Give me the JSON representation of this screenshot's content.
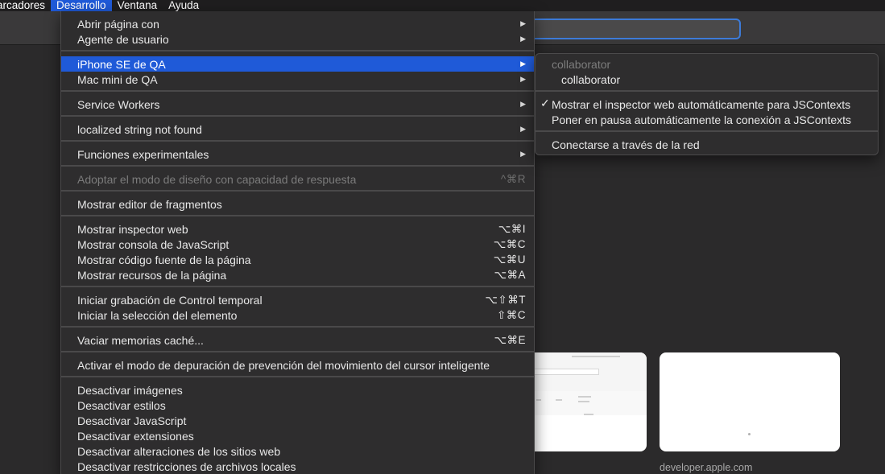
{
  "menubar": {
    "items": [
      {
        "label": "arcadores",
        "active": false
      },
      {
        "label": "Desarrollo",
        "active": true
      },
      {
        "label": "Ventana",
        "active": false
      },
      {
        "label": "Ayuda",
        "active": false
      }
    ]
  },
  "menu": {
    "items": [
      {
        "label": "Abrir página con",
        "shortcut": "",
        "submenu": true
      },
      {
        "label": "Agente de usuario",
        "shortcut": "",
        "submenu": true
      },
      {
        "label": "iPhone SE de QA",
        "shortcut": "",
        "submenu": true,
        "highlighted": true
      },
      {
        "label": "Mac mini de QA",
        "shortcut": "",
        "submenu": true
      },
      {
        "label": "Service Workers",
        "shortcut": "",
        "submenu": true
      },
      {
        "label": "localized string not found",
        "shortcut": "",
        "submenu": true
      },
      {
        "label": "Funciones experimentales",
        "shortcut": "",
        "submenu": true
      },
      {
        "label": "Adoptar el modo de diseño con capacidad de respuesta",
        "shortcut": "^⌘R",
        "disabled": true
      },
      {
        "label": "Mostrar editor de fragmentos",
        "shortcut": ""
      },
      {
        "label": "Mostrar inspector web",
        "shortcut": "⌥⌘I"
      },
      {
        "label": "Mostrar consola de JavaScript",
        "shortcut": "⌥⌘C"
      },
      {
        "label": "Mostrar código fuente de la página",
        "shortcut": "⌥⌘U"
      },
      {
        "label": "Mostrar recursos de la página",
        "shortcut": "⌥⌘A"
      },
      {
        "label": "Iniciar grabación de Control temporal",
        "shortcut": "⌥⇧⌘T"
      },
      {
        "label": "Iniciar la selección del elemento",
        "shortcut": "⇧⌘C"
      },
      {
        "label": "Vaciar memorias caché...",
        "shortcut": "⌥⌘E"
      },
      {
        "label": "Activar el modo de depuración de prevención del movimiento del cursor inteligente",
        "shortcut": ""
      },
      {
        "label": "Desactivar imágenes",
        "shortcut": ""
      },
      {
        "label": "Desactivar estilos",
        "shortcut": ""
      },
      {
        "label": "Desactivar JavaScript",
        "shortcut": ""
      },
      {
        "label": "Desactivar extensiones",
        "shortcut": ""
      },
      {
        "label": "Desactivar alteraciones de los sitios web",
        "shortcut": ""
      },
      {
        "label": "Desactivar restricciones de archivos locales",
        "shortcut": ""
      }
    ]
  },
  "submenu": {
    "header": "collaborator",
    "items": [
      {
        "label": "collaborator",
        "checked": false
      },
      {
        "label": "Mostrar el inspector web automáticamente para JSContexts",
        "checked": true
      },
      {
        "label": "Poner en pausa automáticamente la conexión a JSContexts",
        "checked": false
      },
      {
        "label": "Conectarse a través de la red",
        "checked": false
      }
    ],
    "check_glyph": "✓"
  },
  "glyphs": {
    "arrow": "▶"
  },
  "tiles": {
    "caption": "developer.apple.com"
  }
}
